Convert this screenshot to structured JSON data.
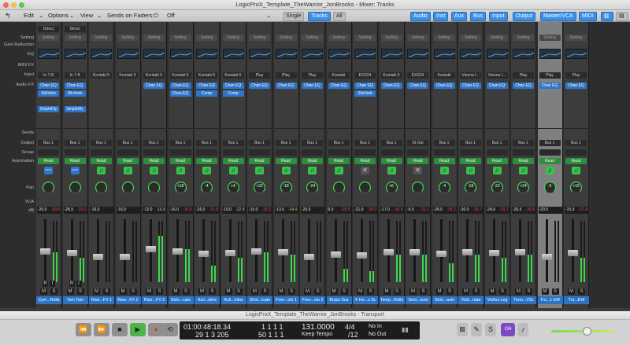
{
  "window_title": "LogicProX_Template_TheWarrior_JonBrooks - Mixer: Tracks",
  "toolbar": {
    "edit": "Edit",
    "options": "Options",
    "view": "View",
    "sends_on_faders": "Sends on Faders:",
    "off": "Off",
    "scope_tabs": [
      "Single",
      "Tracks",
      "All"
    ],
    "filter_tabs": [
      "Audio",
      "Inst",
      "Aux",
      "Bus",
      "Input",
      "Output",
      "Master/VCA",
      "MIDI"
    ]
  },
  "row_labels": {
    "setting": "Setting",
    "gain_reduction": "Gain Reduction",
    "eq": "EQ",
    "midi_fx": "MIDI FX",
    "input": "Input",
    "audio_fx": "Audio FX",
    "sends": "Sends",
    "output": "Output",
    "group": "Group",
    "automation": "Automation",
    "pan": "Pan",
    "vca": "VCA",
    "db": "dB"
  },
  "strips": [
    {
      "name": "Cym...Rolls",
      "input": "In 7-8",
      "fx": [
        "Chan EQ",
        "SilvVerb",
        "",
        "SmpleDly"
      ],
      "output": "Bus 1",
      "auto": "Read",
      "icon": "audio",
      "pan": "",
      "db": "-20.0",
      "peak": "-30.8",
      "green": false,
      "direct": "Direct",
      "ri": true,
      "level": 0.55
    },
    {
      "name": "Tam Tam",
      "input": "In 7-8",
      "fx": [
        "Chan EQ",
        "SilvVerb",
        "",
        "SmpleDly"
      ],
      "output": "Bus 1",
      "auto": "Read",
      "icon": "audio",
      "pan": "",
      "db": "-28.9",
      "peak": "-29.0",
      "green": false,
      "direct": "Direct",
      "ri": true,
      "level": 0.45
    },
    {
      "name": "Rise...FX 1",
      "input": "Kontakt 5",
      "fx": [],
      "output": "Bus 1",
      "auto": "Read",
      "icon": "midi",
      "pan": "",
      "db": "-16.0",
      "peak": "",
      "green": false,
      "level": 0.0
    },
    {
      "name": "Rise...FX 2",
      "input": "Kontakt 5",
      "fx": [],
      "output": "Bus 1",
      "auto": "Read",
      "icon": "midi",
      "pan": "",
      "db": "-16.0",
      "peak": "",
      "green": false,
      "level": 0.0
    },
    {
      "name": "Rise...FX 3",
      "input": "Kontakt 5",
      "fx": [
        "Chan EQ"
      ],
      "output": "Bus 1",
      "auto": "Read",
      "icon": "midi",
      "pan": "",
      "db": "-12.0",
      "peak": "-16.8",
      "green": true,
      "level": 0.85
    },
    {
      "name": "Strin...cato",
      "input": "Kontakt 5",
      "fx": [
        "Chan EQ",
        "Chan EQ"
      ],
      "output": "Bus 1",
      "auto": "Read",
      "icon": "midi",
      "pan": "+18",
      "db": "-16.0",
      "peak": "-16.9",
      "green": false,
      "level": 0.6
    },
    {
      "name": "Acti...olins",
      "input": "Kontakt 5",
      "fx": [
        "Chan EQ",
        "Comp"
      ],
      "output": "Bus 1",
      "auto": "Read",
      "icon": "midi",
      "pan": "-4",
      "db": "-26.0",
      "peak": "-31.8",
      "green": false,
      "level": 0.3
    },
    {
      "name": "Acti...ellos",
      "input": "Kontakt 5",
      "fx": [
        "Chan EQ",
        "Comp"
      ],
      "output": "Bus 1",
      "auto": "Read",
      "icon": "midi",
      "pan": "+4",
      "db": "-19.0",
      "peak": "-22.8",
      "green": true,
      "level": 0.45
    },
    {
      "name": "Strin...icato",
      "input": "Play",
      "fx": [
        "Chan EQ"
      ],
      "output": "Bus 1",
      "auto": "Read",
      "icon": "midi",
      "pan": "+22",
      "db": "-15.0",
      "peak": "-15.2",
      "green": false,
      "level": 0.55
    },
    {
      "name": "Fren...oio 1",
      "input": "Play",
      "fx": [
        "Chan EQ"
      ],
      "output": "Bus 1",
      "auto": "Read",
      "icon": "midi",
      "pan": "-18",
      "db": "-13.6",
      "peak": "-24.9",
      "green": true,
      "level": 0.5
    },
    {
      "name": "Fren...oio 2",
      "input": "Play",
      "fx": [
        "Chan EQ"
      ],
      "output": "Bus 1",
      "auto": "Read",
      "icon": "midi",
      "pan": "-24",
      "db": "-20.0",
      "peak": "",
      "green": false,
      "level": 0.0
    },
    {
      "name": "Brass Sus",
      "input": "Kontakt",
      "fx": [
        "Chan EQ"
      ],
      "output": "Bus 1",
      "auto": "Read",
      "icon": "midi",
      "pan": "",
      "db": "6.0",
      "peak": "-28.5",
      "green": false,
      "level": 0.25
    },
    {
      "name": "F Ho...s 3s",
      "input": "EXS24",
      "fx": [
        "Chan EQ",
        "SilvVerb"
      ],
      "output": "Bus 1",
      "auto": "Read",
      "icon": "x",
      "pan": "",
      "db": "-21.0",
      "peak": "-28.9",
      "green": false,
      "level": 0.2
    },
    {
      "name": "Temp...Rolls",
      "input": "Kontakt 5",
      "fx": [
        "Chan EQ"
      ],
      "output": "Bus 1",
      "auto": "Read",
      "icon": "midi",
      "pan": "+6",
      "db": "-17.0",
      "peak": "-16.9",
      "green": false,
      "level": 0.5
    },
    {
      "name": "Soni...oom",
      "input": "EXS24",
      "fx": [
        "Chan EQ"
      ],
      "output": "St Out",
      "auto": "Read",
      "icon": "x",
      "pan": "",
      "db": "-6.5",
      "peak": "-21.1",
      "green": false,
      "level": 0.5
    },
    {
      "name": "Strin...asto",
      "input": "Kontakt",
      "fx": [
        "Chan EQ"
      ],
      "output": "Bus 1",
      "auto": "Read",
      "icon": "midi",
      "pan": "-4",
      "db": "-26.0",
      "peak": "-39.2",
      "green": false,
      "level": 0.35
    },
    {
      "name": "Violi...nata",
      "input": "Vienna I...",
      "fx": [
        "Chan EQ"
      ],
      "output": "Bus 1",
      "auto": "Read",
      "icon": "midi",
      "pan": "-18",
      "db": "-30.0",
      "peak": "-36.7",
      "green": false,
      "level": 0.5
    },
    {
      "name": "Violins Leg",
      "input": "Vienna I...",
      "fx": [
        "Chan EQ"
      ],
      "output": "Bus 1",
      "auto": "Read",
      "icon": "midi",
      "pan": "-23",
      "db": "-24.0",
      "peak": "-33.1",
      "green": false,
      "level": 0.45
    },
    {
      "name": "Trom...VSL",
      "input": "Play",
      "fx": [
        "Chan EQ"
      ],
      "output": "Bus 1",
      "auto": "Read",
      "icon": "midi",
      "pan": "+24",
      "db": "-26.5",
      "peak": "-26.8",
      "green": false,
      "level": 0.5
    },
    {
      "name": "Tru...1 EW",
      "input": "Play",
      "fx": [
        "Chan EQ"
      ],
      "output": "Bus 1",
      "auto": "Read",
      "icon": "midi",
      "pan": "-3",
      "db": "-20.0",
      "peak": "",
      "green": false,
      "selected": true,
      "level": 0.0
    },
    {
      "name": "Tru...EW",
      "input": "Play",
      "fx": [
        "Chan EQ"
      ],
      "output": "Bus 1",
      "auto": "Read",
      "icon": "midi",
      "pan": "+15",
      "db": "-15.0",
      "peak": "-27.4",
      "green": false,
      "level": 0.45
    }
  ],
  "transport": {
    "title": "LogicProX_Template_TheWarrior_JonBrooks - Transport",
    "smpte_top": "01:00:48:18.34",
    "smpte_bottom": "29  1  3  205",
    "bars_top": "1  1  1  1",
    "bars_bottom": "50  1  1  1",
    "tempo": "131.0000",
    "keep_tempo": "Keep Tempo",
    "sig": "4/4",
    "div": "/12",
    "no_in": "No In",
    "no_out": "No Out",
    "cpu": "r34"
  },
  "colors": {
    "accent": "#3a8ee6",
    "read": "#2f8d3e",
    "name": "#2e74c5"
  }
}
